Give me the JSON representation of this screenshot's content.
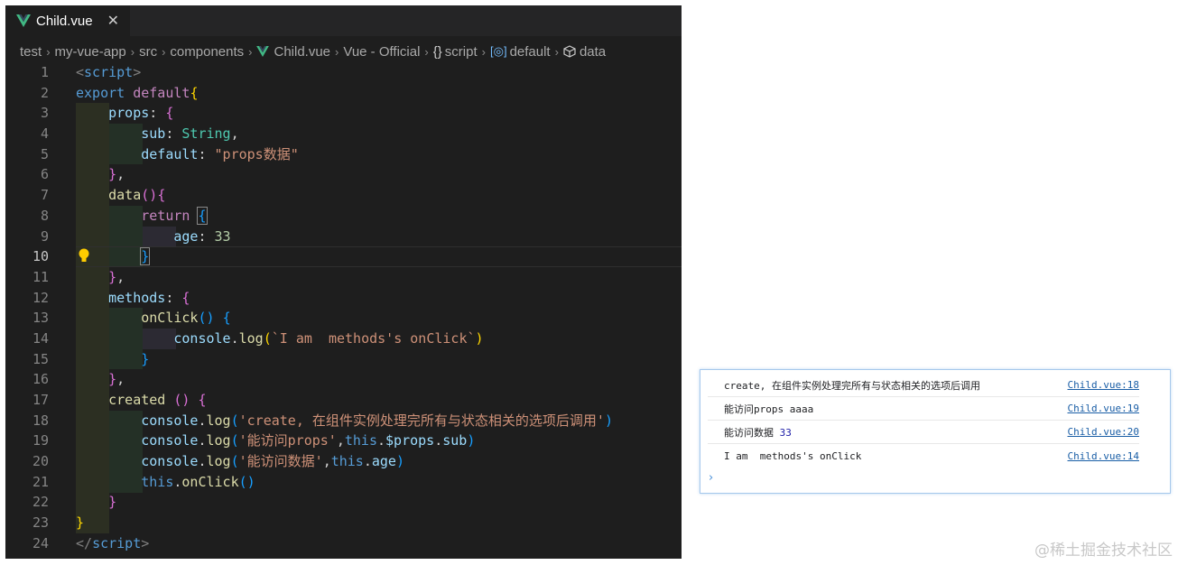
{
  "tab": {
    "file_name": "Child.vue",
    "close_glyph": "✕"
  },
  "breadcrumb": {
    "items": [
      "test",
      "my-vue-app",
      "src",
      "components",
      "Child.vue",
      "Vue - Official",
      "script",
      "default",
      "data"
    ],
    "separator": "›",
    "icons": [
      "vue-logo-icon",
      "braces-icon",
      "namespace-icon",
      "cube-icon"
    ]
  },
  "code": {
    "current_line": 10,
    "lines": [
      {
        "n": "1",
        "tokens": [
          [
            "t-tag",
            "<"
          ],
          [
            "t-tagname",
            "script"
          ],
          [
            "t-tag",
            ">"
          ]
        ]
      },
      {
        "n": "2",
        "tokens": [
          [
            "t-kw",
            "export "
          ],
          [
            "t-ctrl",
            "default"
          ],
          [
            "b1",
            "{"
          ]
        ]
      },
      {
        "n": "3",
        "tokens": [
          [
            "",
            "    "
          ],
          [
            "t-prop",
            "props"
          ],
          [
            "",
            ": "
          ],
          [
            "b2",
            "{"
          ]
        ]
      },
      {
        "n": "4",
        "tokens": [
          [
            "",
            "        "
          ],
          [
            "t-prop",
            "sub"
          ],
          [
            "",
            ": "
          ],
          [
            "t-type",
            "String"
          ],
          [
            "",
            ","
          ]
        ]
      },
      {
        "n": "5",
        "tokens": [
          [
            "",
            "        "
          ],
          [
            "t-prop",
            "default"
          ],
          [
            "",
            ": "
          ],
          [
            "t-str",
            "\"props数据\""
          ]
        ]
      },
      {
        "n": "6",
        "tokens": [
          [
            "",
            "    "
          ],
          [
            "b2",
            "}"
          ],
          [
            "",
            ","
          ]
        ]
      },
      {
        "n": "7",
        "tokens": [
          [
            "",
            "    "
          ],
          [
            "t-fn",
            "data"
          ],
          [
            "b2",
            "()"
          ],
          [
            "",
            "",
            " "
          ],
          [
            "b2",
            "{"
          ]
        ]
      },
      {
        "n": "8",
        "tokens": [
          [
            "",
            "        "
          ],
          [
            "t-ctrl",
            "return"
          ],
          [
            "",
            " "
          ],
          [
            "b3 bh",
            "{"
          ]
        ]
      },
      {
        "n": "9",
        "tokens": [
          [
            "",
            "            "
          ],
          [
            "t-prop",
            "age"
          ],
          [
            "",
            ": "
          ],
          [
            "t-num",
            "33"
          ]
        ]
      },
      {
        "n": "10",
        "tokens": [
          [
            "",
            "        "
          ],
          [
            "b3 bh",
            "}"
          ]
        ]
      },
      {
        "n": "11",
        "tokens": [
          [
            "",
            "    "
          ],
          [
            "b2",
            "}"
          ],
          [
            "",
            ","
          ]
        ]
      },
      {
        "n": "12",
        "tokens": [
          [
            "",
            "    "
          ],
          [
            "t-prop",
            "methods"
          ],
          [
            "",
            ": "
          ],
          [
            "b2",
            "{"
          ]
        ]
      },
      {
        "n": "13",
        "tokens": [
          [
            "",
            "        "
          ],
          [
            "t-fn",
            "onClick"
          ],
          [
            "b3",
            "()"
          ],
          [
            "",
            " "
          ],
          [
            "b3",
            "{"
          ]
        ]
      },
      {
        "n": "14",
        "tokens": [
          [
            "",
            "            "
          ],
          [
            "t-prop",
            "console"
          ],
          [
            "",
            "."
          ],
          [
            "t-fn",
            "log"
          ],
          [
            "b1",
            "("
          ],
          [
            "t-str",
            "`I am  methods's onClick`"
          ],
          [
            "b1",
            ")"
          ]
        ]
      },
      {
        "n": "15",
        "tokens": [
          [
            "",
            "        "
          ],
          [
            "b3",
            "}"
          ]
        ]
      },
      {
        "n": "16",
        "tokens": [
          [
            "",
            "    "
          ],
          [
            "b2",
            "}"
          ],
          [
            "",
            ","
          ]
        ]
      },
      {
        "n": "17",
        "tokens": [
          [
            "",
            "    "
          ],
          [
            "t-fn",
            "created"
          ],
          [
            "",
            " "
          ],
          [
            "b2",
            "()"
          ],
          [
            "",
            " "
          ],
          [
            "b2",
            "{"
          ]
        ]
      },
      {
        "n": "18",
        "tokens": [
          [
            "",
            "        "
          ],
          [
            "t-prop",
            "console"
          ],
          [
            "",
            "."
          ],
          [
            "t-fn",
            "log"
          ],
          [
            "b3",
            "("
          ],
          [
            "t-str",
            "'create, 在组件实例处理完所有与状态相关的选项后调用'"
          ],
          [
            "b3",
            ")"
          ]
        ]
      },
      {
        "n": "19",
        "tokens": [
          [
            "",
            "        "
          ],
          [
            "t-prop",
            "console"
          ],
          [
            "",
            "."
          ],
          [
            "t-fn",
            "log"
          ],
          [
            "b3",
            "("
          ],
          [
            "t-str",
            "'能访问props'"
          ],
          [
            "",
            ","
          ],
          [
            "t-kw",
            "this"
          ],
          [
            "",
            "."
          ],
          [
            "t-prop",
            "$props"
          ],
          [
            "",
            "."
          ],
          [
            "t-prop",
            "sub"
          ],
          [
            "b3",
            ")"
          ]
        ]
      },
      {
        "n": "20",
        "tokens": [
          [
            "",
            "        "
          ],
          [
            "t-prop",
            "console"
          ],
          [
            "",
            "."
          ],
          [
            "t-fn",
            "log"
          ],
          [
            "b3",
            "("
          ],
          [
            "t-str",
            "'能访问数据'"
          ],
          [
            "",
            ","
          ],
          [
            "t-kw",
            "this"
          ],
          [
            "",
            "."
          ],
          [
            "t-prop",
            "age"
          ],
          [
            "b3",
            ")"
          ]
        ]
      },
      {
        "n": "21",
        "tokens": [
          [
            "",
            "        "
          ],
          [
            "t-kw",
            "this"
          ],
          [
            "",
            "."
          ],
          [
            "t-fn",
            "onClick"
          ],
          [
            "b3",
            "()"
          ]
        ]
      },
      {
        "n": "22",
        "tokens": [
          [
            "",
            "    "
          ],
          [
            "b2",
            "}"
          ]
        ]
      },
      {
        "n": "23",
        "tokens": [
          [
            "b1",
            "}"
          ]
        ]
      },
      {
        "n": "24",
        "tokens": [
          [
            "t-tag",
            "</"
          ],
          [
            "t-tagname",
            "script"
          ],
          [
            "t-tag",
            ">"
          ]
        ]
      }
    ]
  },
  "console": {
    "rows": [
      {
        "text": "create, 在组件实例处理完所有与状态相关的选项后调用",
        "value": "",
        "source": "Child.vue:18"
      },
      {
        "text": "能访问props aaaa",
        "value": "",
        "source": "Child.vue:19"
      },
      {
        "text": "能访问数据 ",
        "value": "33",
        "source": "Child.vue:20"
      },
      {
        "text": "I am  methods's onClick",
        "value": "",
        "source": "Child.vue:14"
      }
    ],
    "prompt": "›"
  },
  "watermark": "@稀土掘金技术社区",
  "colors": {
    "editor_bg": "#1e1e1e",
    "vue_green": "#41b883",
    "console_link": "#1a5ea6"
  }
}
